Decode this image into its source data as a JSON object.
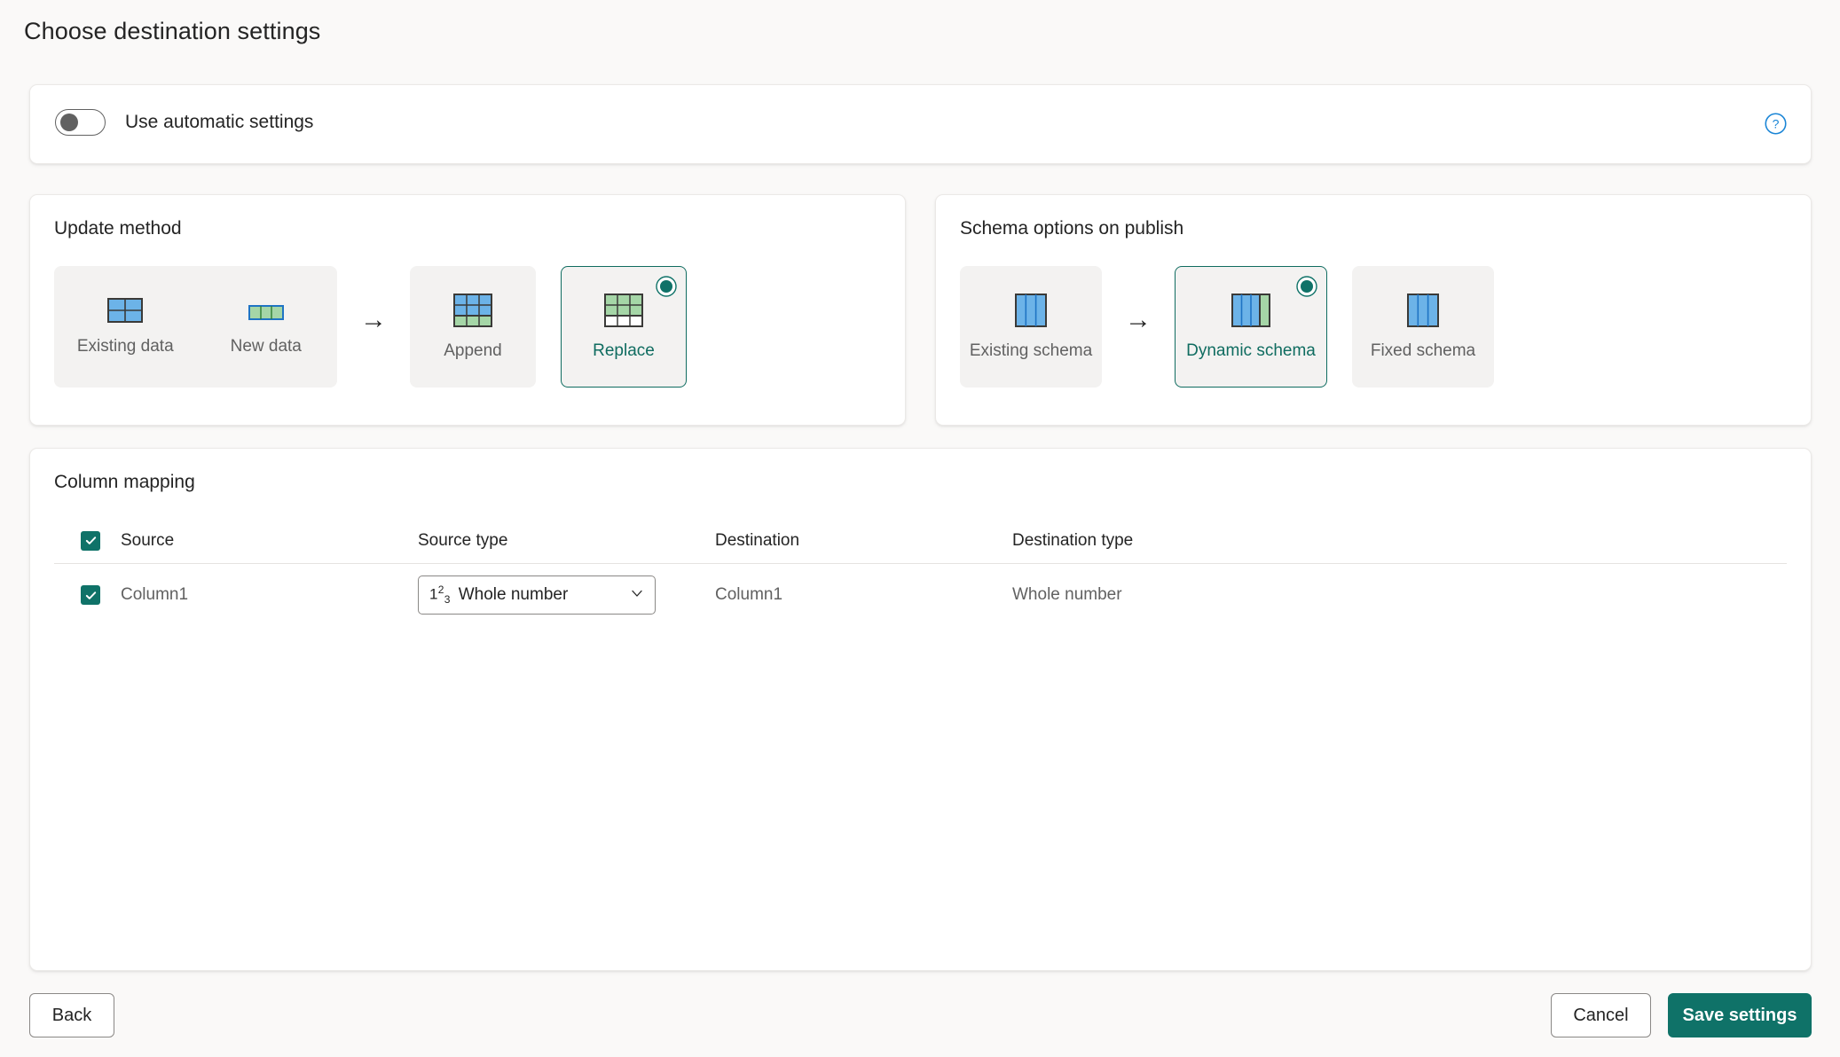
{
  "page": {
    "title": "Choose destination settings"
  },
  "auto_settings": {
    "toggle_label": "Use automatic settings",
    "toggle_state": "off",
    "help_icon": "help-circle-icon",
    "help_color": "#1a85d6"
  },
  "update_method": {
    "heading": "Update method",
    "source_tile": {
      "items": [
        {
          "label": "Existing data",
          "icon": "grid-table-blue-icon"
        },
        {
          "label": "New data",
          "icon": "grid-row-green-icon"
        }
      ]
    },
    "arrow": "→",
    "options": [
      {
        "label": "Append",
        "icon": "grid-append-icon",
        "selected": false
      },
      {
        "label": "Replace",
        "icon": "grid-replace-icon",
        "selected": true
      }
    ]
  },
  "schema_options": {
    "heading": "Schema options on publish",
    "source_tile": {
      "items": [
        {
          "label": "Existing schema",
          "icon": "columns-blue-icon"
        }
      ]
    },
    "arrow": "→",
    "options": [
      {
        "label": "Dynamic schema",
        "icon": "columns-dynamic-icon",
        "selected": true
      },
      {
        "label": "Fixed schema",
        "icon": "columns-fixed-icon",
        "selected": false
      }
    ]
  },
  "column_mapping": {
    "heading": "Column mapping",
    "select_all_checked": true,
    "columns": [
      "Source",
      "Source type",
      "Destination",
      "Destination type"
    ],
    "rows": [
      {
        "checked": true,
        "source": "Column1",
        "source_type": "Whole number",
        "source_type_glyph": "123-whole-number-icon",
        "destination": "Column1",
        "destination_type": "Whole number"
      }
    ]
  },
  "footer": {
    "back_label": "Back",
    "cancel_label": "Cancel",
    "save_label": "Save settings"
  },
  "colors": {
    "accent_teal": "#0f7268",
    "selected_border": "#0f6c60",
    "icon_blue": "#6cb3e8",
    "icon_green": "#a5d6a7",
    "help_blue": "#1a85d6",
    "page_bg": "#faf9f8",
    "tile_bg": "#f3f2f1"
  }
}
